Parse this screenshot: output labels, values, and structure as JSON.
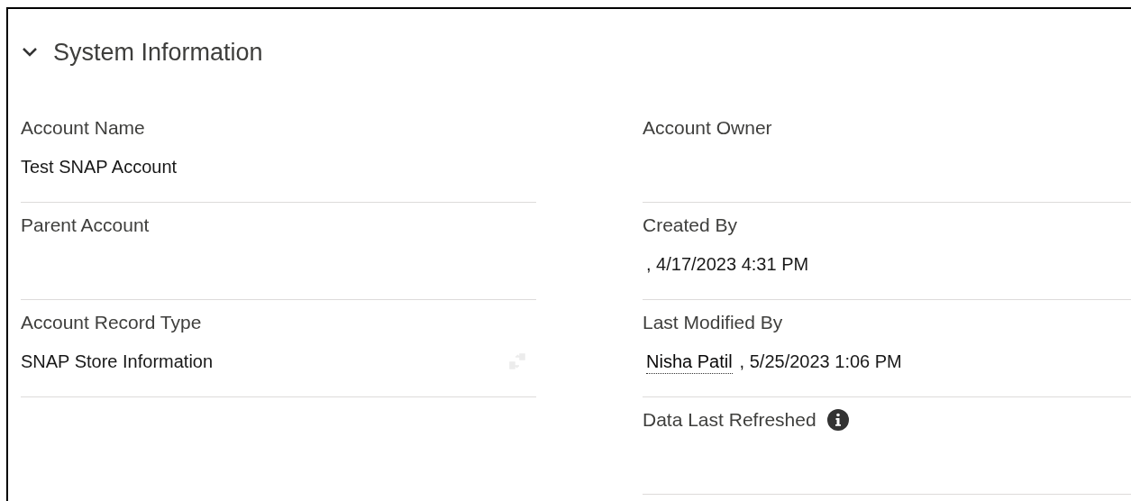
{
  "section": {
    "title": "System Information",
    "expanded": true
  },
  "left_fields": [
    {
      "kind": "text",
      "label": "Account Name",
      "value": "Test SNAP Account"
    },
    {
      "kind": "text",
      "label": "Parent Account"
    },
    {
      "kind": "record_type",
      "label": "Account Record Type",
      "value": "SNAP Store Information"
    }
  ],
  "right_fields": [
    {
      "kind": "text",
      "label": "Account Owner"
    },
    {
      "kind": "user_date",
      "label": "Created By",
      "value": ", 4/17/2023 4:31 PM"
    },
    {
      "kind": "user_date",
      "label": "Last Modified By",
      "link": "Nisha Patil",
      "value": ", 5/25/2023 1:06 PM"
    },
    {
      "kind": "info",
      "label": "Data Last Refreshed"
    }
  ]
}
